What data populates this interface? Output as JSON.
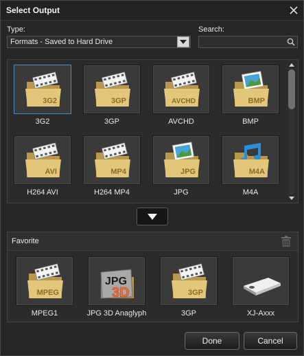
{
  "window": {
    "title": "Select Output"
  },
  "type_field": {
    "label": "Type:",
    "value": "Formats - Saved to Hard Drive"
  },
  "search_field": {
    "label": "Search:",
    "value": "",
    "placeholder": ""
  },
  "formats": [
    {
      "name": "3G2",
      "badge": "3G2",
      "kind": "video"
    },
    {
      "name": "3GP",
      "badge": "3GP",
      "kind": "video"
    },
    {
      "name": "AVCHD",
      "badge": "AVCHD",
      "kind": "video"
    },
    {
      "name": "BMP",
      "badge": "BMP",
      "kind": "image"
    },
    {
      "name": "H264 AVI",
      "badge": "AVI",
      "kind": "video"
    },
    {
      "name": "H264 MP4",
      "badge": "MP4",
      "kind": "video"
    },
    {
      "name": "JPG",
      "badge": "JPG",
      "kind": "image"
    },
    {
      "name": "M4A",
      "badge": "M4A",
      "kind": "audio"
    }
  ],
  "favorite": {
    "title": "Favorite",
    "items": [
      {
        "name": "MPEG1",
        "badge": "MPEG",
        "kind": "video"
      },
      {
        "name": "JPG 3D Anaglyph",
        "badge": "JPG",
        "badge2": "3D",
        "kind": "jpg3d"
      },
      {
        "name": "3GP",
        "badge": "3GP",
        "kind": "video"
      },
      {
        "name": "XJ-Axxx",
        "badge": "",
        "kind": "projector"
      }
    ]
  },
  "buttons": {
    "done": "Done",
    "cancel": "Cancel"
  },
  "colors": {
    "accent_selected": "#4a8cc7",
    "folder": "#e2c679",
    "panel": "#2b2b2b"
  }
}
